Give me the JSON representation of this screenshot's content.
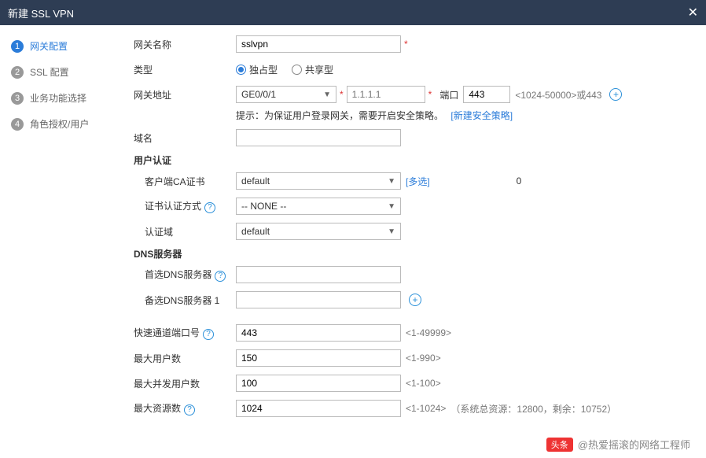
{
  "title": "新建 SSL VPN",
  "steps": [
    {
      "num": "1",
      "label": "网关配置",
      "active": true
    },
    {
      "num": "2",
      "label": "SSL 配置",
      "active": false
    },
    {
      "num": "3",
      "label": "业务功能选择",
      "active": false
    },
    {
      "num": "4",
      "label": "角色授权/用户",
      "active": false
    }
  ],
  "form": {
    "gateway_name_label": "网关名称",
    "gateway_name_value": "sslvpn",
    "type_label": "类型",
    "type_exclusive": "独占型",
    "type_shared": "共享型",
    "gateway_addr_label": "网关地址",
    "interface_value": "GE0/0/1",
    "ip_placeholder": "1.1.1.1",
    "port_label": "端口",
    "port_value": "443",
    "port_range": "<1024-50000>或443",
    "tip_prefix": "提示：为保证用户登录网关，需要开启安全策略。",
    "tip_link": "[新建安全策略]",
    "domain_label": "域名",
    "user_auth_head": "用户认证",
    "client_ca_label": "客户端CA证书",
    "client_ca_value": "default",
    "multi_select": "[多选]",
    "zero": "0",
    "cert_auth_label": "证书认证方式",
    "cert_auth_value": "-- NONE --",
    "auth_domain_label": "认证域",
    "auth_domain_value": "default",
    "dns_head": "DNS服务器",
    "dns_primary_label": "首选DNS服务器",
    "dns_backup_label": "备选DNS服务器 1",
    "rapid_port_label": "快速通道端口号",
    "rapid_port_value": "443",
    "rapid_port_range": "<1-49999>",
    "max_users_label": "最大用户数",
    "max_users_value": "150",
    "max_users_range": "<1-990>",
    "max_concurrent_label": "最大并发用户数",
    "max_concurrent_value": "100",
    "max_concurrent_range": "<1-100>",
    "max_res_label": "最大资源数",
    "max_res_value": "1024",
    "max_res_range": "<1-1024>",
    "max_res_hint": "（系统总资源：12800，剩余：10752）"
  },
  "watermark": {
    "badge": "头条",
    "text": "@热爱摇滚的网络工程师"
  }
}
